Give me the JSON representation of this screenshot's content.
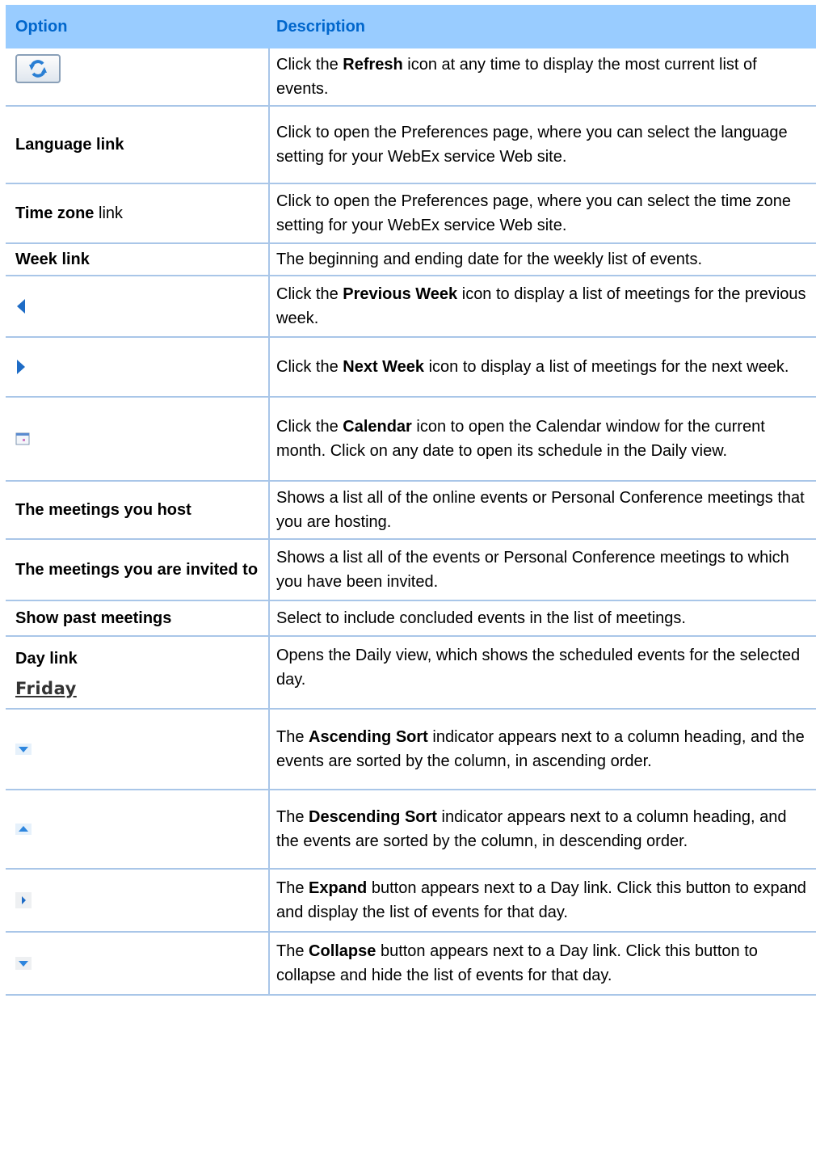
{
  "header": {
    "option": "Option",
    "description": "Description"
  },
  "rows": [
    {
      "option": "",
      "icon": "refresh-icon",
      "desc": [
        {
          "t": "Click the "
        },
        {
          "b": "Refresh"
        },
        {
          "t": " icon at any time to display the most current list of events."
        }
      ]
    },
    {
      "option": "Language link",
      "desc": [
        {
          "t": "Click to open the Preferences page, where you can select the language setting for your WebEx service Web site."
        }
      ]
    },
    {
      "option_bold": "Time zone",
      "option_rest": " link",
      "desc": [
        {
          "t": "Click to open the Preferences page, where you can select the time zone setting for your WebEx service Web site."
        }
      ]
    },
    {
      "option": "Week link",
      "desc": [
        {
          "t": "The beginning and ending date for the weekly list of events."
        }
      ]
    },
    {
      "option": "",
      "icon": "previous-week-icon",
      "desc": [
        {
          "t": "Click the "
        },
        {
          "b": "Previous Week"
        },
        {
          "t": " icon to display a list of meetings for the previous week."
        }
      ]
    },
    {
      "option": "",
      "icon": "next-week-icon",
      "desc": [
        {
          "t": "Click the "
        },
        {
          "b": "Next Week"
        },
        {
          "t": " icon to display a list of meetings for the next week."
        }
      ]
    },
    {
      "option": "",
      "icon": "calendar-icon",
      "desc": [
        {
          "t": "Click the "
        },
        {
          "b": "Calendar"
        },
        {
          "t": " icon to open the Calendar window for the current month. Click on any date to open its schedule in the Daily view."
        }
      ]
    },
    {
      "option": "The meetings you host",
      "desc": [
        {
          "t": "Shows a list all of the online events or Personal Conference meetings that you are hosting."
        }
      ]
    },
    {
      "option": "The meetings you are invited to",
      "desc": [
        {
          "t": "Shows a list all of the events or Personal Conference meetings to which you have been invited."
        }
      ]
    },
    {
      "option": "Show past meetings",
      "desc": [
        {
          "t": "Select to include concluded events in the list of meetings."
        }
      ]
    },
    {
      "option": "Day link",
      "sub": "Friday",
      "desc": [
        {
          "t": "Opens the Daily view, which shows the scheduled events for the selected day."
        }
      ]
    },
    {
      "option": "",
      "icon": "ascending-sort-icon",
      "desc": [
        {
          "t": "The "
        },
        {
          "b": "Ascending Sort"
        },
        {
          "t": " indicator appears next to a column heading, and the events are sorted by the column, in ascending order."
        }
      ]
    },
    {
      "option": "",
      "icon": "descending-sort-icon",
      "desc": [
        {
          "t": "The "
        },
        {
          "b": "Descending Sort"
        },
        {
          "t": " indicator appears next to a column heading, and the events are sorted by the column, in descending order."
        }
      ]
    },
    {
      "option": "",
      "icon": "expand-icon",
      "desc": [
        {
          "t": "The "
        },
        {
          "b": "Expand"
        },
        {
          "t": " button appears next to a Day link. Click this button to expand and display the list of events for that day."
        }
      ]
    },
    {
      "option": "",
      "icon": "collapse-icon",
      "desc": [
        {
          "t": "The "
        },
        {
          "b": "Collapse"
        },
        {
          "t": " button appears next to a Day link. Click this button to collapse and hide the list of events for that day."
        }
      ]
    }
  ]
}
